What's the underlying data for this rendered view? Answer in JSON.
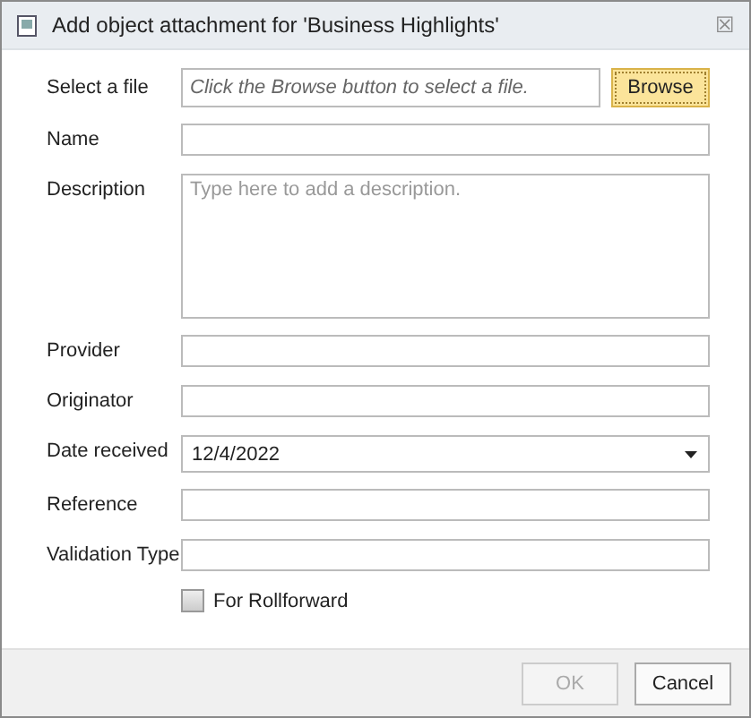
{
  "window": {
    "title": "Add object attachment for 'Business Highlights'",
    "close": "☒"
  },
  "fields": [
    {
      "kind": "file",
      "label": "Select a file",
      "placeholder": "Click the Browse button to select a file.",
      "button": "Browse"
    },
    {
      "kind": "text",
      "label": "Name"
    },
    {
      "kind": "textarea",
      "label": "Description",
      "placeholder": "Type here to add a description."
    },
    {
      "kind": "text",
      "label": "Provider"
    },
    {
      "kind": "text",
      "label": "Originator"
    },
    {
      "kind": "date",
      "label": "Date received",
      "value": "12/4/2022"
    },
    {
      "kind": "text",
      "label": "Reference"
    },
    {
      "kind": "text",
      "label": "Validation Type"
    },
    {
      "kind": "checkbox",
      "label": "For Rollforward",
      "checked": false
    }
  ],
  "buttons": [
    {
      "label": "OK",
      "disabled": true
    },
    {
      "label": "Cancel",
      "disabled": false
    }
  ]
}
